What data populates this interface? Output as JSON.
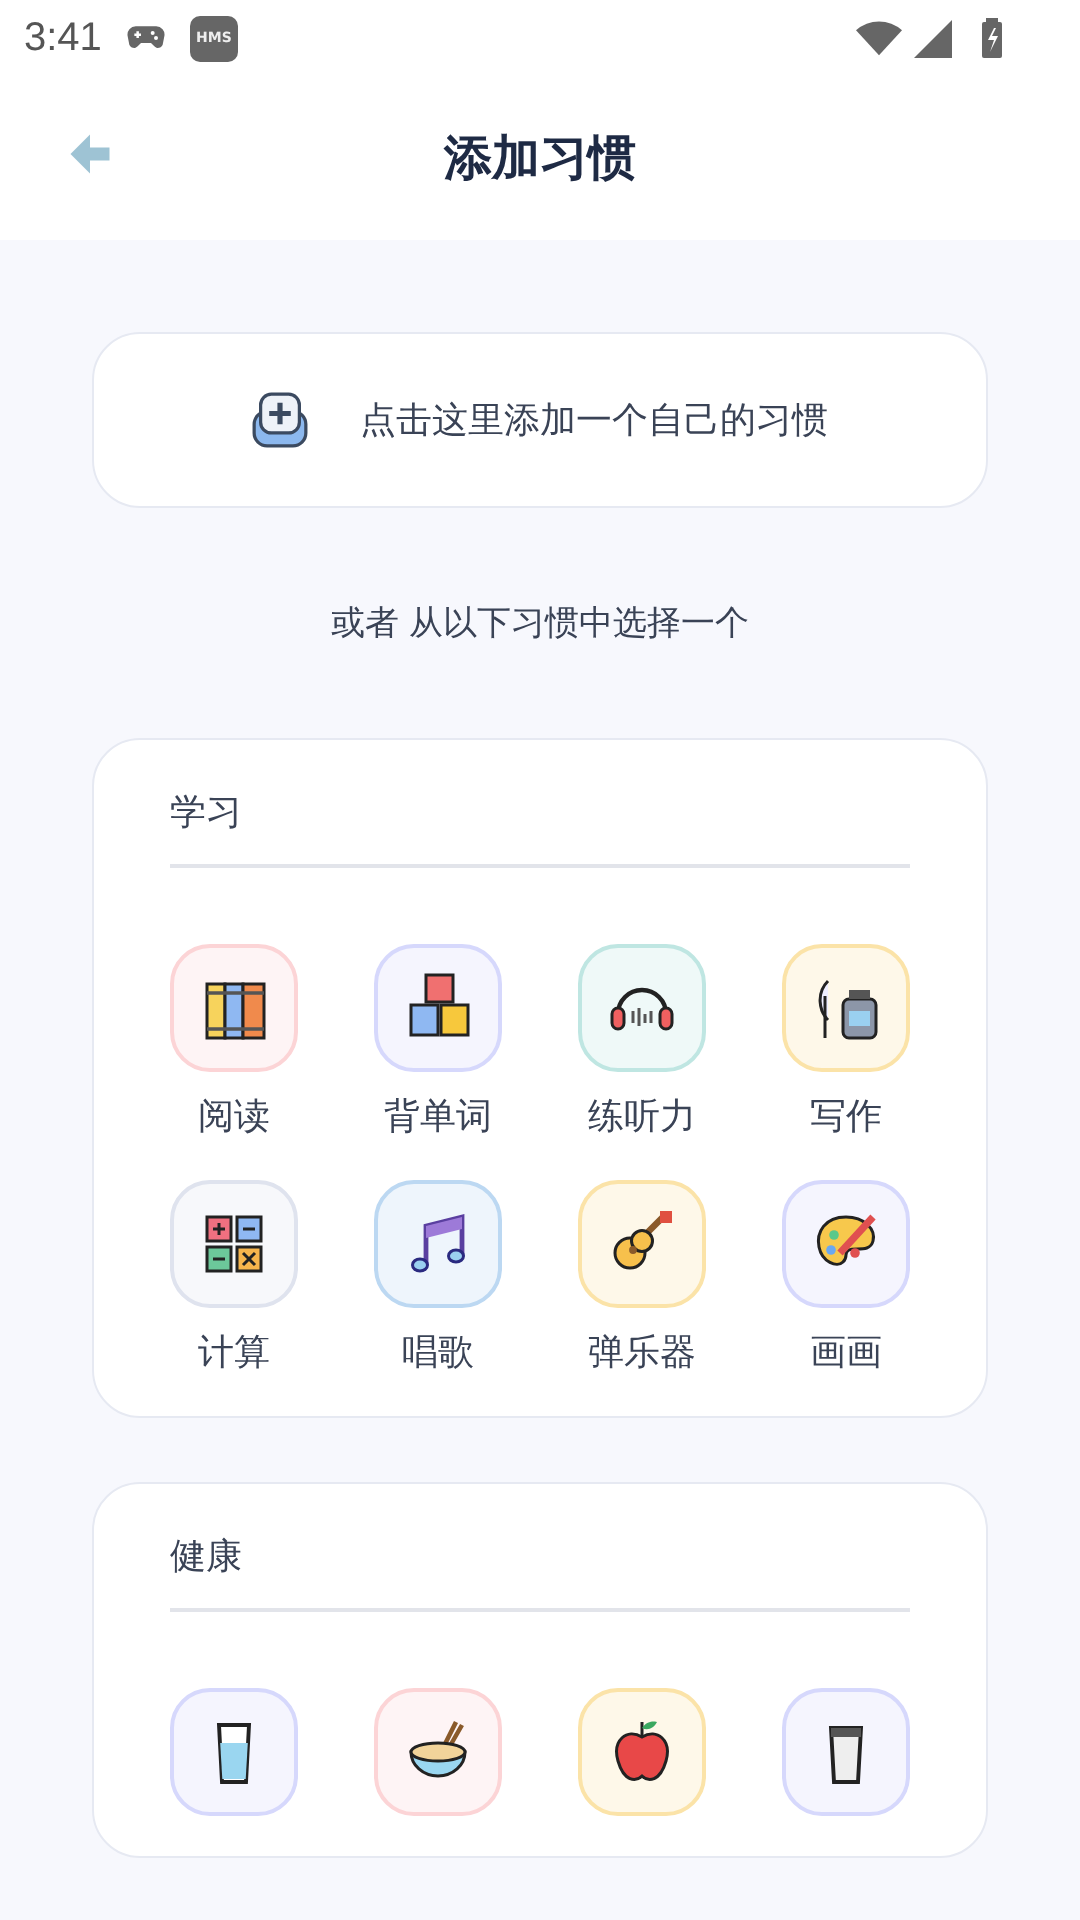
{
  "status_bar": {
    "time": "3:41",
    "badge": "HMS"
  },
  "header": {
    "title": "添加习惯"
  },
  "custom_button": {
    "label": "点击这里添加一个自己的习惯"
  },
  "hint": "或者 从以下习惯中选择一个",
  "sections": [
    {
      "title": "学习",
      "items": [
        {
          "label": "阅读",
          "color": "#fcd4d6"
        },
        {
          "label": "背单词",
          "color": "#d6d8fc"
        },
        {
          "label": "练听力",
          "color": "#bfe6e2"
        },
        {
          "label": "写作",
          "color": "#fbe3a8"
        },
        {
          "label": "计算",
          "color": "#dfe3ee"
        },
        {
          "label": "唱歌",
          "color": "#bcd8f2"
        },
        {
          "label": "弹乐器",
          "color": "#fbe3a8"
        },
        {
          "label": "画画",
          "color": "#d6d8fc"
        }
      ]
    },
    {
      "title": "健康",
      "items": [
        {
          "color": "#d6d8fc"
        },
        {
          "color": "#fcd4d6"
        },
        {
          "color": "#fbe3a8"
        },
        {
          "color": "#d6d8fc"
        }
      ]
    }
  ]
}
